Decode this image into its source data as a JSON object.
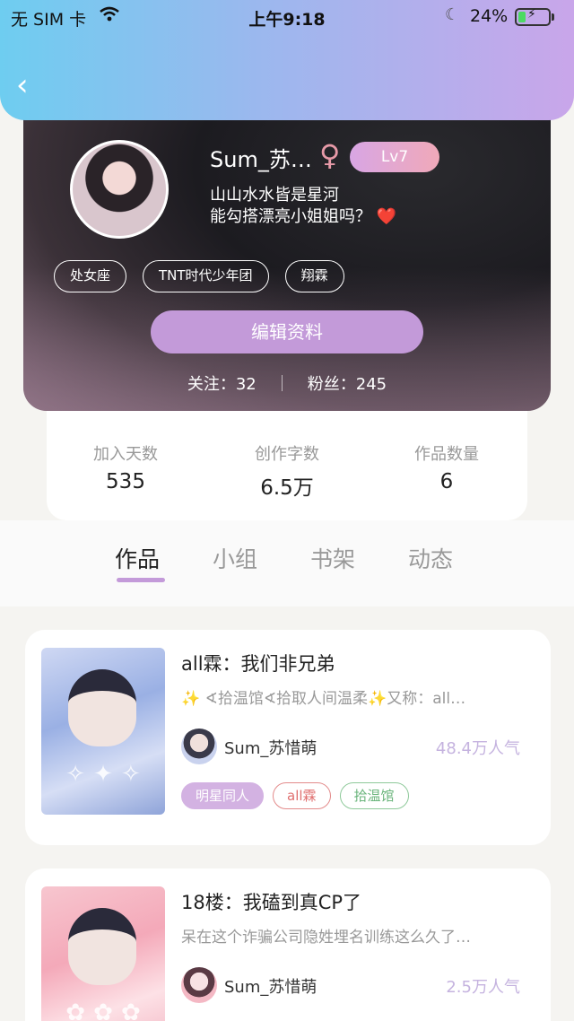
{
  "status_bar": {
    "carrier": "无 SIM 卡",
    "time": "上午9:18",
    "battery": "24%",
    "battery_level": 0.24
  },
  "nav": {
    "back_icon": "chevron-left-icon"
  },
  "profile": {
    "username": "Sum_苏…",
    "gender_symbol": "♀",
    "level": "Lv7",
    "bio_line1": "山山水水皆是星河",
    "bio_line2": "能勾搭漂亮小姐姐吗？",
    "bio_emoji": "❤️",
    "tags": [
      "处女座",
      "TNT时代少年团",
      "翔霖"
    ],
    "edit_button": "编辑资料",
    "following_label": "关注：32",
    "followers_label": "粉丝：245"
  },
  "stats": [
    {
      "label": "加入天数",
      "value": "535"
    },
    {
      "label": "创作字数",
      "value": "6.5万"
    },
    {
      "label": "作品数量",
      "value": "6"
    }
  ],
  "tabs": [
    {
      "label": "作品",
      "active": true
    },
    {
      "label": "小组",
      "active": false
    },
    {
      "label": "书架",
      "active": false
    },
    {
      "label": "动态",
      "active": false
    }
  ],
  "books": [
    {
      "title": "all霖：我们非兄弟",
      "description": "✨ ∢拾温馆∢拾取人间温柔✨又称：all…",
      "author": "Sum_苏惜萌",
      "popularity": "48.4万人气",
      "tags": [
        "明星同人",
        "all霖",
        "拾温馆"
      ]
    },
    {
      "title": "18楼：我磕到真CP了",
      "description": "呆在这个诈骗公司隐姓埋名训练这么久了…",
      "author": "Sum_苏惜萌",
      "popularity": "2.5万人气"
    }
  ],
  "colors": {
    "accent": "#c39ad9",
    "header_gradient_start": "#6ecdf0",
    "header_gradient_end": "#c9a6ea",
    "popularity": "#c5b3df"
  }
}
